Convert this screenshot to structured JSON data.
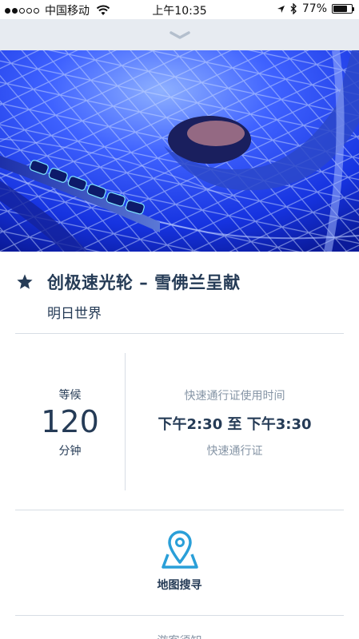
{
  "status_bar": {
    "carrier": "中国移动",
    "time": "上午10:35",
    "battery": "77%",
    "battery_level": 0.77
  },
  "attraction": {
    "title": "创极速光轮 – 雪佛兰呈献",
    "land": "明日世界"
  },
  "wait": {
    "label": "等候",
    "minutes": "120",
    "unit": "分钟"
  },
  "fastpass": {
    "label": "快速通行证使用时间",
    "window": "下午2:30 至 下午3:30",
    "type": "快速通行证"
  },
  "actions": {
    "map_search": "地图搜寻"
  },
  "next_section": "游客须知",
  "colors": {
    "text": "#253b56",
    "muted": "#8695a6",
    "accent": "#2a9fd8",
    "header_bg": "#e7ebf1"
  }
}
